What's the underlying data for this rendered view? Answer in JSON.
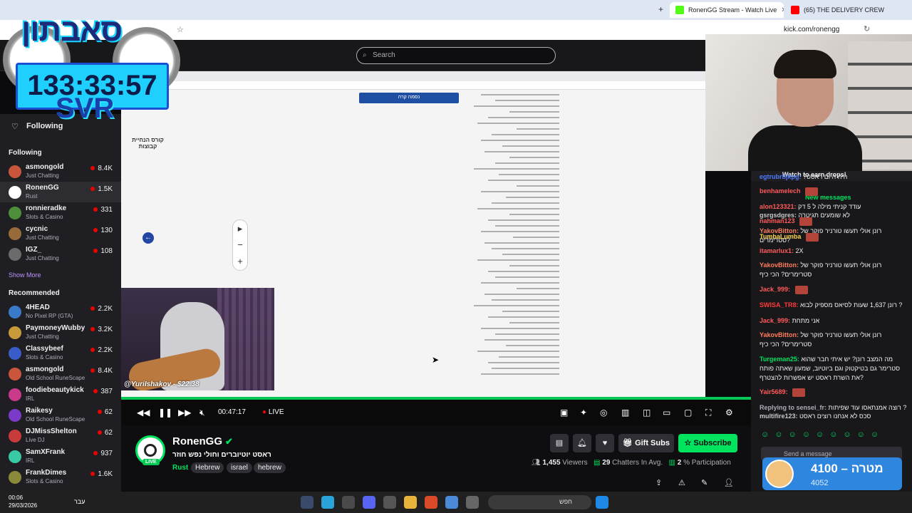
{
  "browser": {
    "tabs": [
      {
        "title": "RonenGG Stream - Watch Live",
        "fav": "#53fc18"
      },
      {
        "title": "(65) THE DELIVERY CREW",
        "fav": "#ff0000"
      }
    ],
    "url": "kick.com/ronengg"
  },
  "header": {
    "search_placeholder": "Search"
  },
  "overlay": {
    "brand": "סאבתון",
    "timer": "133:33:57",
    "tag": "SVR"
  },
  "sidebar": {
    "following_label": "Following",
    "following_title": "Following",
    "recommended_title": "Recommended",
    "show_more": "Show More",
    "following": [
      {
        "name": "asmongold",
        "category": "Just Chatting",
        "viewers": "8.4K",
        "color": "#c9553a"
      },
      {
        "name": "RonenGG",
        "category": "Rust",
        "viewers": "1.5K",
        "color": "#ffffff"
      },
      {
        "name": "ronnieradke",
        "category": "Slots & Casino",
        "viewers": "331",
        "color": "#4d8f3a"
      },
      {
        "name": "cycnic",
        "category": "Just Chatting",
        "viewers": "130",
        "color": "#9a6b3a"
      },
      {
        "name": "IGZ_",
        "category": "Just Chatting",
        "viewers": "108",
        "color": "#6b6b6b"
      }
    ],
    "recommended": [
      {
        "name": "4HEAD",
        "category": "No Pixel RP (GTA)",
        "viewers": "2.2K",
        "color": "#3a7bc9"
      },
      {
        "name": "PaymoneyWubby",
        "category": "Just Chatting",
        "viewers": "3.2K",
        "color": "#c99a3a"
      },
      {
        "name": "Classybeef",
        "category": "Slots & Casino",
        "viewers": "2.2K",
        "color": "#3a5cc9"
      },
      {
        "name": "asmongold",
        "category": "Old School RuneScape",
        "viewers": "8.4K",
        "color": "#c9553a"
      },
      {
        "name": "foodiebeautykick",
        "category": "IRL",
        "viewers": "387",
        "color": "#c93a8a"
      },
      {
        "name": "Raikesy",
        "category": "Old School RuneScape",
        "viewers": "62",
        "color": "#7b3ac9"
      },
      {
        "name": "DJMissShelton",
        "category": "Live DJ",
        "viewers": "62",
        "color": "#c93a3a"
      },
      {
        "name": "SamXFrank",
        "category": "IRL",
        "viewers": "937",
        "color": "#3ac9a5"
      },
      {
        "name": "FrankDimes",
        "category": "Slots & Casino",
        "viewers": "1.6K",
        "color": "#8a8a3a"
      }
    ]
  },
  "video": {
    "course_title": "קורס הנחיית קבוצות",
    "inner_button": "נסמה קרה",
    "cam_label": "@YuriIshakov - $22.38",
    "time": "00:47:17",
    "live": "LIVE"
  },
  "channel": {
    "name": "RonenGG",
    "live_tag": "LIVE",
    "title": "ראסט יוטיוברים וחולי נפש חוזר",
    "game": "Rust",
    "tags": [
      "Hebrew",
      "israel",
      "hebrew"
    ],
    "gift_subs": "Gift Subs",
    "subscribe": "Subscribe",
    "viewers": "1,455",
    "viewers_label": "Viewers",
    "chatters": "29",
    "chatters_label": "Chatters In Avg.",
    "participation": "2",
    "participation_label": "% Participation"
  },
  "chat": {
    "drops": "Watch to earn drops!",
    "new_messages": "New messages",
    "messages": [
      {
        "user": "egtrubrbjkpg:",
        "text": "?היה היום ראסט",
        "color": "#4f7cff"
      },
      {
        "user": "benhamelech",
        "text": "",
        "color": "#ff5a5a"
      },
      {
        "user": "alon123321:",
        "text": "עודד קניתי מילה ל 5 דק",
        "color": "#ff5a5a"
      },
      {
        "user": "gsrgsdgres:",
        "text": "לא שומעים תגיטרה",
        "color": "#c8c8c8"
      },
      {
        "user": "nahman123",
        "text": "",
        "color": "#ff5a5a"
      },
      {
        "user": "YakovBitton:",
        "text": "רונן אולי תעשו טורניר פוקר של סטרימרים?",
        "color": "#ff7c5a"
      },
      {
        "user": "TumbaLumba",
        "text": "",
        "color": "#ffd24a"
      },
      {
        "user": "itamarlux1:",
        "text": "2X",
        "color": "#ff5a5a"
      },
      {
        "user": "YakovBitton:",
        "text": "רונן אולי תעשו טורניר פוקר של סטרימרים? הכי כיף",
        "color": "#ff7c5a"
      },
      {
        "user": "Jack_999:",
        "text": "",
        "color": "#ff5a5a"
      },
      {
        "user": "SWISA_TR8:",
        "text": "רונן 1,637 שעות לסיאס מספיק לבוא ?",
        "color": "#ff3a3a"
      },
      {
        "user": "Jack_999:",
        "text": "אני מתחת",
        "color": "#ff5a5a"
      },
      {
        "user": "YakovBitton:",
        "text": "רונן אולי תעשו טורניר פוקר של סטרימרים? הכי כיף",
        "color": "#ff7c5a"
      },
      {
        "user": "Turgeman25:",
        "text": "מה המצב רונן? יש איתי חבר שהוא סטרימר גם בטיקטוק וגם ביוטיוב, שמעון שאתה פותח את השרת ראסט יש אפשרות להצטרף?",
        "color": "#00e35e"
      },
      {
        "user": "Yair5689:",
        "text": "",
        "color": "#ff5a5a"
      },
      {
        "user": "Replying to sensei_fr:",
        "text": "רוצה אמנתאסו עוד שפיתות ?",
        "color": "#adadb8"
      },
      {
        "user": "multifire123:",
        "text": "סכס לא אנחנו רוצים ראסט",
        "color": "#c8c8c8"
      }
    ],
    "send_placeholder": "Send a message",
    "goal_label": "4100 – מטרה",
    "goal_value": "4052"
  },
  "taskbar": {
    "time": "00:06",
    "date": "29/03/2026",
    "search_text": "חפש",
    "lang": "עבר"
  }
}
